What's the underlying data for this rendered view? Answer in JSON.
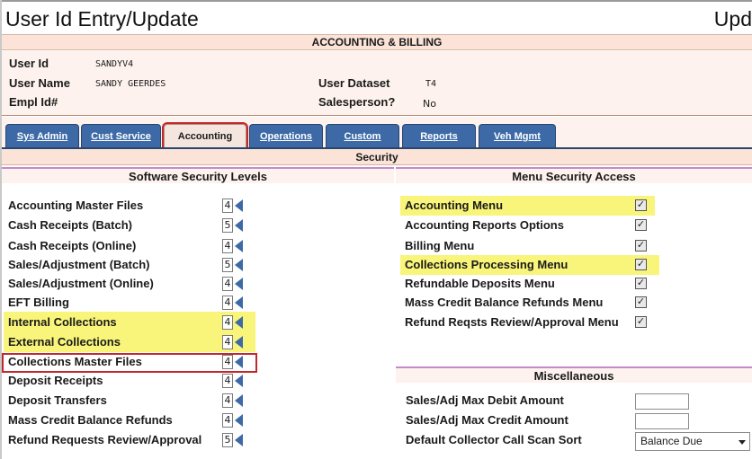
{
  "page": {
    "title": "User Id Entry/Update",
    "title_right": "Upd",
    "section": "ACCOUNTING & BILLING"
  },
  "user_info": {
    "user_id_label": "User Id",
    "user_id_value": "SANDYV4",
    "user_name_label": "User Name",
    "user_name_value": "SANDY GEERDES",
    "empl_id_label": "Empl Id#",
    "empl_id_value": "",
    "user_dataset_label": "User Dataset",
    "user_dataset_value": "T4",
    "salesperson_label": "Salesperson?",
    "salesperson_value": "No"
  },
  "tabs": [
    {
      "label": "Sys Admin",
      "active": false
    },
    {
      "label": "Cust Service",
      "active": false
    },
    {
      "label": "Accounting",
      "active": true
    },
    {
      "label": "Operations",
      "active": false
    },
    {
      "label": "Custom",
      "active": false
    },
    {
      "label": "Reports",
      "active": false
    },
    {
      "label": "Veh Mgmt",
      "active": false
    }
  ],
  "security": {
    "title": "Security",
    "software_title": "Software Security Levels",
    "levels": [
      {
        "label": "Accounting Master Files",
        "value": "4",
        "highlighted": false
      },
      {
        "label": "Cash Receipts (Batch)",
        "value": "5",
        "highlighted": false
      },
      {
        "label": "Cash Receipts (Online)",
        "value": "4",
        "highlighted": false
      },
      {
        "label": "Sales/Adjustment (Batch)",
        "value": "5",
        "highlighted": false
      },
      {
        "label": "Sales/Adjustment (Online)",
        "value": "4",
        "highlighted": false
      },
      {
        "label": "EFT Billing",
        "value": "4",
        "highlighted": false
      },
      {
        "label": "Internal Collections",
        "value": "4",
        "highlighted": true
      },
      {
        "label": "External Collections",
        "value": "4",
        "highlighted": true
      },
      {
        "label": "Collections Master Files",
        "value": "4",
        "highlighted": false,
        "outlined": true
      },
      {
        "label": "Deposit Receipts",
        "value": "4",
        "highlighted": false
      },
      {
        "label": "Deposit Transfers",
        "value": "4",
        "highlighted": false
      },
      {
        "label": "Mass Credit Balance Refunds",
        "value": "4",
        "highlighted": false
      },
      {
        "label": "Refund Requests Review/Approval",
        "value": "5",
        "highlighted": false
      }
    ],
    "menu_title": "Menu Security Access",
    "menus": [
      {
        "label": "Accounting Menu",
        "checked": true,
        "highlighted": true
      },
      {
        "label": "Accounting Reports Options",
        "checked": true,
        "highlighted": false
      },
      {
        "label": "Billing Menu",
        "checked": true,
        "highlighted": false
      },
      {
        "label": "Collections Processing Menu",
        "checked": true,
        "highlighted": true
      },
      {
        "label": "Refundable Deposits Menu",
        "checked": true,
        "highlighted": false
      },
      {
        "label": "Mass Credit Balance Refunds Menu",
        "checked": true,
        "highlighted": false
      },
      {
        "label": "Refund Reqsts Review/Approval Menu",
        "checked": true,
        "highlighted": false
      }
    ],
    "misc_title": "Miscellaneous",
    "misc": {
      "debit_label": "Sales/Adj Max Debit Amount",
      "debit_value": "",
      "credit_label": "Sales/Adj Max Credit Amount",
      "credit_value": "",
      "sort_label": "Default Collector Call Scan Sort",
      "sort_value": "Balance Due"
    }
  },
  "colors": {
    "highlight": "#f8f57a",
    "tab_blue": "#3d6aa6",
    "outline_red": "#c0282d",
    "panel_bg": "#fdf2ee"
  }
}
